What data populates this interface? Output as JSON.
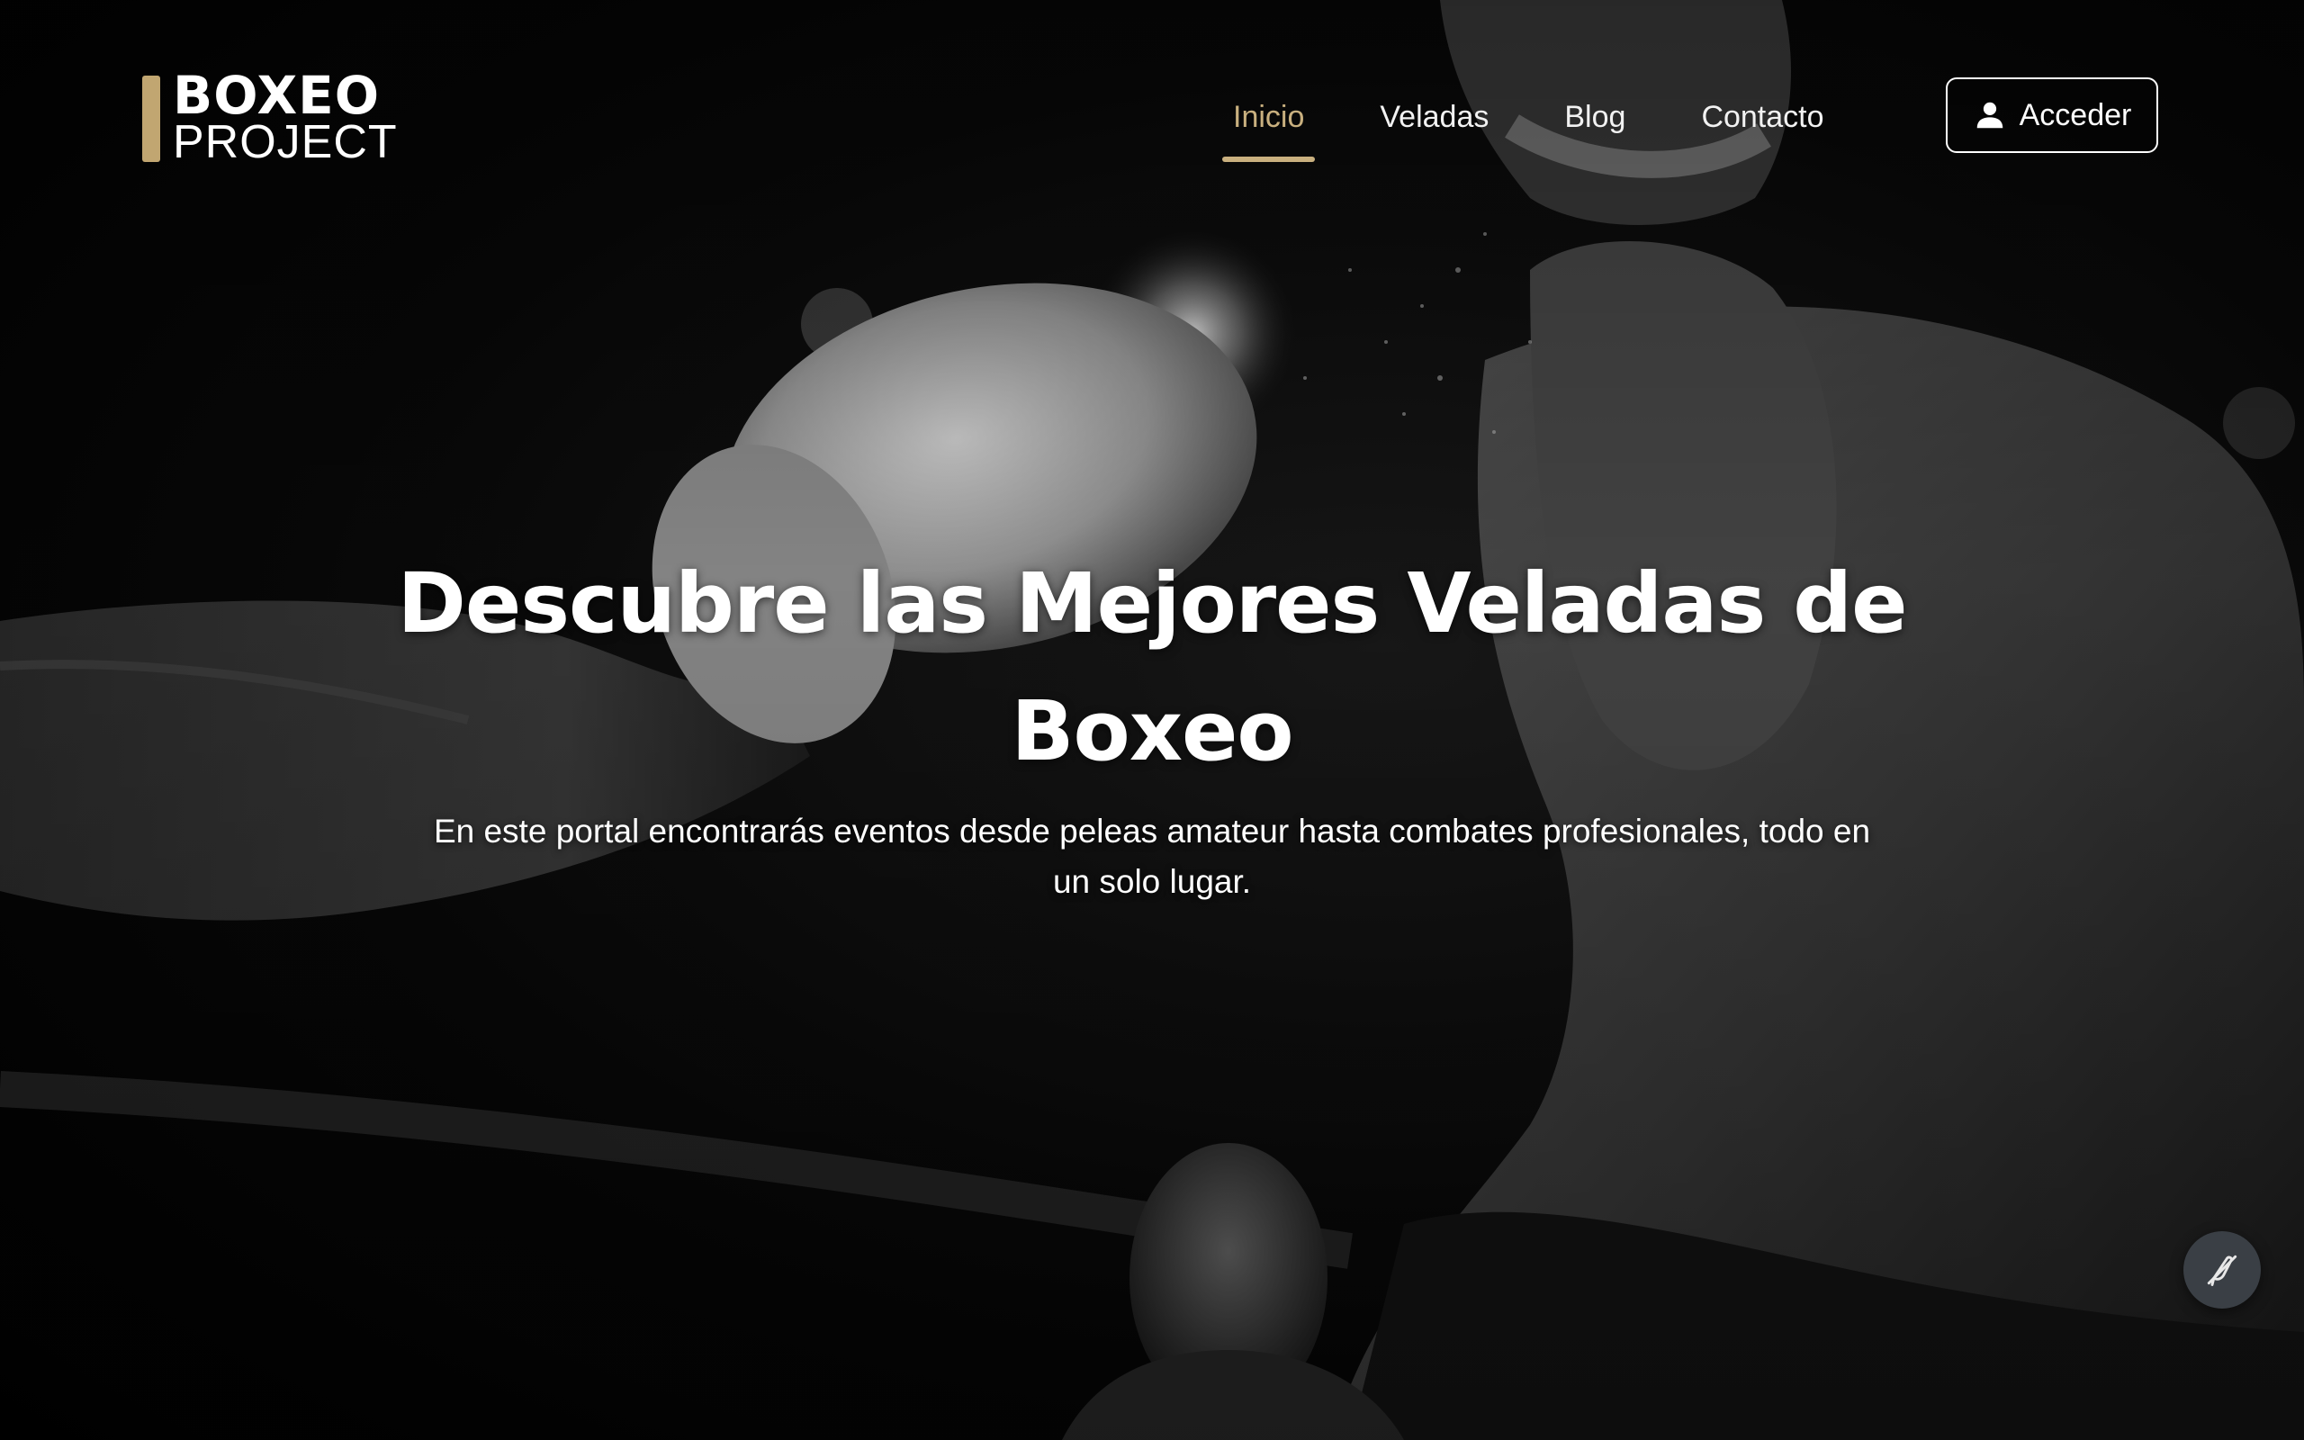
{
  "header": {
    "logo": {
      "word1": "BOXEO",
      "word2": "PROJECT",
      "accent_color": "#c1a671"
    },
    "nav": [
      {
        "label": "Inicio",
        "active": true
      },
      {
        "label": "Veladas",
        "active": false
      },
      {
        "label": "Blog",
        "active": false
      },
      {
        "label": "Contacto",
        "active": false
      }
    ],
    "login": {
      "label": "Acceder",
      "icon": "user-icon"
    },
    "active_color": "#c9b07f"
  },
  "hero": {
    "title": "Descubre las Mejores Veladas de Boxeo",
    "subtitle": "En este portal encontrarás eventos desde peleas amateur hasta combates profesionales, todo en un solo lugar.",
    "background": "black-and-white boxing photo"
  },
  "fab": {
    "icon": "slashed-pen-icon",
    "color": "#3a3f45"
  }
}
